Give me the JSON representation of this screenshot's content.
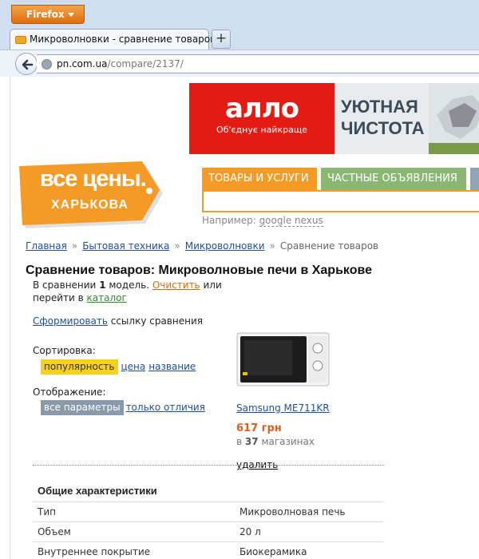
{
  "browser": {
    "menu_button": "Firefox",
    "tab_title": "Микроволновки - сравнение товаров",
    "tab_close": "✕",
    "new_tab": "+",
    "url_host": "pn.com.ua",
    "url_path": "/compare/2137/"
  },
  "banner": {
    "brand": "аллo",
    "tagline": "Об'єднує найкраще",
    "headline_line1": "УЮТНАЯ",
    "headline_line2": "ЧИСТОТА"
  },
  "logo": {
    "line1": "все цены.",
    "line2": "ХАРЬКОВА"
  },
  "header": {
    "tabs": [
      {
        "label": "ТОВАРЫ И УСЛУГИ"
      },
      {
        "label": "ЧАСТНЫЕ ОБЪЯВЛЕНИЯ"
      }
    ],
    "search_hint_prefix": "Например:",
    "search_hint_example": "google nexus"
  },
  "breadcrumb": {
    "items": [
      "Главная",
      "Бытовая техника",
      "Микроволновки"
    ],
    "current": "Сравнение товаров",
    "separator": "»"
  },
  "page": {
    "title": "Сравнение товаров: Микроволновые печи в Харькове",
    "compare_prefix": "В сравнении",
    "compare_count": "1",
    "compare_suffix": "модель.",
    "clear_link": "Очистить",
    "or_text": "или",
    "goto_text": "перейти в",
    "catalog_link": "каталог",
    "form_link": "Сформировать",
    "form_suffix": "ссылку сравнения",
    "sort_label": "Сортировка:",
    "sort_options": [
      "популярность",
      "цена",
      "название"
    ],
    "view_label": "Отображение:",
    "view_options": [
      "все параметры",
      "только отличия"
    ]
  },
  "product": {
    "name": "Samsung ME711KR",
    "price": "617 грн",
    "shops_prefix": "в",
    "shops_count": "37",
    "shops_suffix": "магазинах",
    "delete_link": "удалить"
  },
  "specs": {
    "title": "Общие характеристики",
    "rows": [
      {
        "key": "Тип",
        "value": "Микроволновая печь"
      },
      {
        "key": "Объем",
        "value": "20 л"
      },
      {
        "key": "Внутреннее покрытие",
        "value": "Биокерамика"
      }
    ]
  },
  "colors": {
    "orange": "#f59a24",
    "green": "#8ab873",
    "link": "#1f4f9c",
    "price": "#e0601a",
    "allo_red": "#e41b13"
  }
}
